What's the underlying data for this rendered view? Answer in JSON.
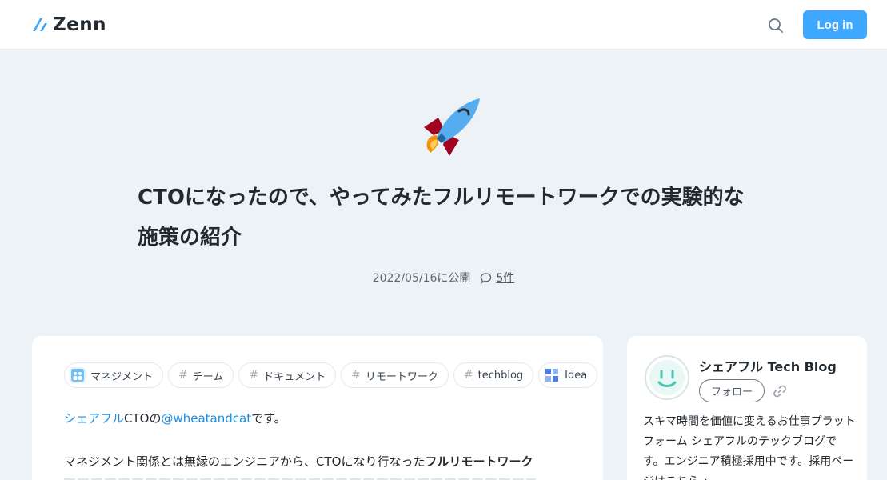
{
  "header": {
    "logo_text": "Zenn",
    "search_icon": "search-icon",
    "login_label": "Log in"
  },
  "article": {
    "emoji": "rocket",
    "title": "CTOになったので、やってみたフルリモートワークでの実験的な施策の紹介",
    "published": "2022/05/16に公開",
    "comments_count": "5件",
    "topics": [
      {
        "label": "マネジメント",
        "icon": "management-topic-icon"
      },
      {
        "label": "チーム",
        "icon": "hash"
      },
      {
        "label": "ドキュメント",
        "icon": "hash"
      },
      {
        "label": "リモートワーク",
        "icon": "hash"
      },
      {
        "label": "techblog",
        "icon": "hash"
      },
      {
        "label": "Idea",
        "icon": "idea-topic-icon"
      }
    ],
    "intro": {
      "company": "シェアフル",
      "role": "CTOの",
      "handle": "@wheatandcat",
      "suffix": "です。"
    },
    "paragraph": {
      "text": "マネジメント関係とは無縁のエンジニアから、CTOになり行なった",
      "bold": "フルリモートワーク"
    }
  },
  "publication": {
    "name": "シェアフル Tech Blog",
    "follow_label": "フォロー",
    "description": "スキマ時間を価値に変えるお仕事プラットフォーム シェアフルのテックブログです。エンジニア積極採用中です。採用ページはこちら→"
  },
  "colors": {
    "accent": "#3ea8ff",
    "link": "#1a8de0",
    "background": "#edf2f7"
  }
}
